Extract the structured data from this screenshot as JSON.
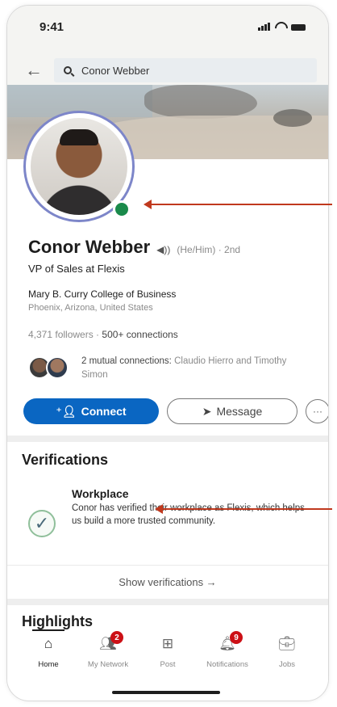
{
  "status_bar": {
    "time": "9:41"
  },
  "search": {
    "query": "Conor Webber"
  },
  "profile": {
    "name": "Conor Webber",
    "pronouns": "(He/Him) · 2nd",
    "headline": "VP of Sales at Flexis",
    "school": "Mary B. Curry College of Business",
    "location": "Phoenix, Arizona, United States",
    "followers": "4,371 followers",
    "connections": "500+ connections",
    "mutual_bold": "2 mutual connections:",
    "mutual_names": "Claudio Hierro and Timothy Simon",
    "online_status_color": "#1a8a4b"
  },
  "actions": {
    "connect_label": "Connect",
    "message_label": "Message",
    "more_label": "···"
  },
  "verifications": {
    "title": "Verifications",
    "item_title": "Workplace",
    "item_description": "Conor has verified their workplace as Flexis, which helps us build a more trusted community.",
    "show_label": "Show verifications →"
  },
  "highlights": {
    "title": "Highlights"
  },
  "bottom_nav": {
    "items": [
      {
        "label": "Home",
        "icon": "home-icon",
        "active": true
      },
      {
        "label": "My Network",
        "icon": "network-icon",
        "badge": "2"
      },
      {
        "label": "Post",
        "icon": "post-icon"
      },
      {
        "label": "Notifications",
        "icon": "bell-icon",
        "badge": "9"
      },
      {
        "label": "Jobs",
        "icon": "briefcase-icon"
      }
    ]
  },
  "colors": {
    "accent": "#0a66c2",
    "annotation_arrow": "#c0391e",
    "badge": "#cc1016"
  }
}
